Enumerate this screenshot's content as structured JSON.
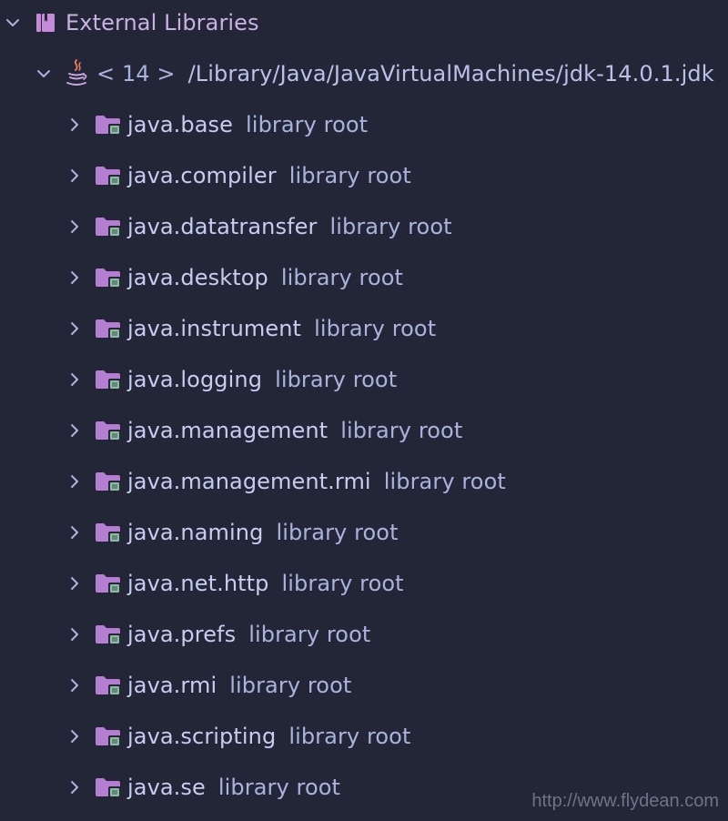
{
  "tree": {
    "root": {
      "label": "External Libraries",
      "expanded": true,
      "icon": "library-icon"
    },
    "sdk": {
      "label": "< 14 >",
      "path": "/Library/Java/JavaVirtualMachines/jdk-14.0.1.jdk",
      "expanded": true,
      "icon": "java-cup-icon"
    },
    "modules": [
      {
        "name": "java.base",
        "suffix": "library root"
      },
      {
        "name": "java.compiler",
        "suffix": "library root"
      },
      {
        "name": "java.datatransfer",
        "suffix": "library root"
      },
      {
        "name": "java.desktop",
        "suffix": "library root"
      },
      {
        "name": "java.instrument",
        "suffix": "library root"
      },
      {
        "name": "java.logging",
        "suffix": "library root"
      },
      {
        "name": "java.management",
        "suffix": "library root"
      },
      {
        "name": "java.management.rmi",
        "suffix": "library root"
      },
      {
        "name": "java.naming",
        "suffix": "library root"
      },
      {
        "name": "java.net.http",
        "suffix": "library root"
      },
      {
        "name": "java.prefs",
        "suffix": "library root"
      },
      {
        "name": "java.rmi",
        "suffix": "library root"
      },
      {
        "name": "java.scripting",
        "suffix": "library root"
      },
      {
        "name": "java.se",
        "suffix": "library root"
      }
    ]
  },
  "watermark": "http://www.flydean.com",
  "colors": {
    "background": "#232636",
    "text": "#a9b4de",
    "library_icon": "#c58ad8",
    "folder_icon": "#b47fd0",
    "folder_badge": "#8fb8a6"
  }
}
